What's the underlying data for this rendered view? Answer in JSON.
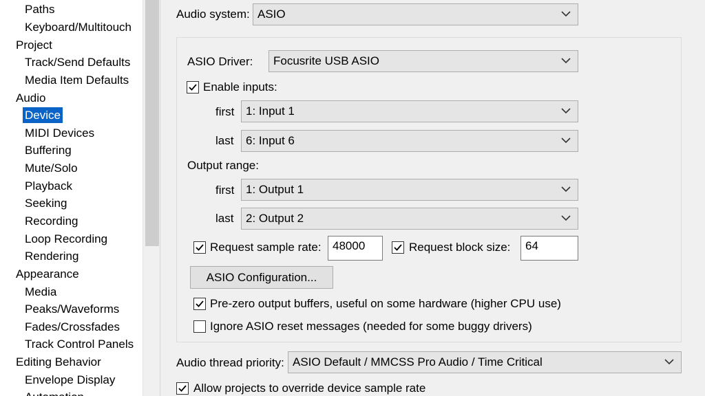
{
  "sidebar": {
    "items": [
      {
        "label": "Paths"
      },
      {
        "label": "Keyboard/Multitouch"
      },
      {
        "label": "Project"
      },
      {
        "label": "Track/Send Defaults"
      },
      {
        "label": "Media Item Defaults"
      },
      {
        "label": "Audio"
      },
      {
        "label": "Device"
      },
      {
        "label": "MIDI Devices"
      },
      {
        "label": "Buffering"
      },
      {
        "label": "Mute/Solo"
      },
      {
        "label": "Playback"
      },
      {
        "label": "Seeking"
      },
      {
        "label": "Recording"
      },
      {
        "label": "Loop Recording"
      },
      {
        "label": "Rendering"
      },
      {
        "label": "Appearance"
      },
      {
        "label": "Media"
      },
      {
        "label": "Peaks/Waveforms"
      },
      {
        "label": "Fades/Crossfades"
      },
      {
        "label": "Track Control Panels"
      },
      {
        "label": "Editing Behavior"
      },
      {
        "label": "Envelope Display"
      },
      {
        "label": "Automation"
      }
    ],
    "selected": "Device"
  },
  "device": {
    "audio_system_label": "Audio system:",
    "audio_system_value": "ASIO",
    "asio_driver_label": "ASIO Driver:",
    "asio_driver_value": "Focusrite USB ASIO",
    "enable_inputs_label": "Enable inputs:",
    "enable_inputs_checked": true,
    "input_first_label": "first",
    "input_first_value": "1: Input 1",
    "input_last_label": "last",
    "input_last_value": "6: Input 6",
    "output_range_label": "Output range:",
    "output_first_label": "first",
    "output_first_value": "1: Output 1",
    "output_last_label": "last",
    "output_last_value": "2: Output 2",
    "request_sample_rate_label": "Request sample rate:",
    "request_sample_rate_checked": true,
    "sample_rate_value": "48000",
    "request_block_size_label": "Request block size:",
    "request_block_size_checked": true,
    "block_size_value": "64",
    "asio_config_button": "ASIO Configuration...",
    "prezero_label": "Pre-zero output buffers, useful on some hardware (higher CPU use)",
    "prezero_checked": true,
    "ignore_reset_label": "Ignore ASIO reset messages (needed for some buggy drivers)",
    "ignore_reset_checked": false,
    "thread_priority_label": "Audio thread priority:",
    "thread_priority_value": "ASIO Default / MMCSS Pro Audio / Time Critical",
    "allow_override_label": "Allow projects to override device sample rate",
    "allow_override_checked": true
  },
  "colors": {
    "selection": "#0a64c8",
    "background": "#f0f0f0",
    "combo_bg": "#e5e5e5"
  }
}
